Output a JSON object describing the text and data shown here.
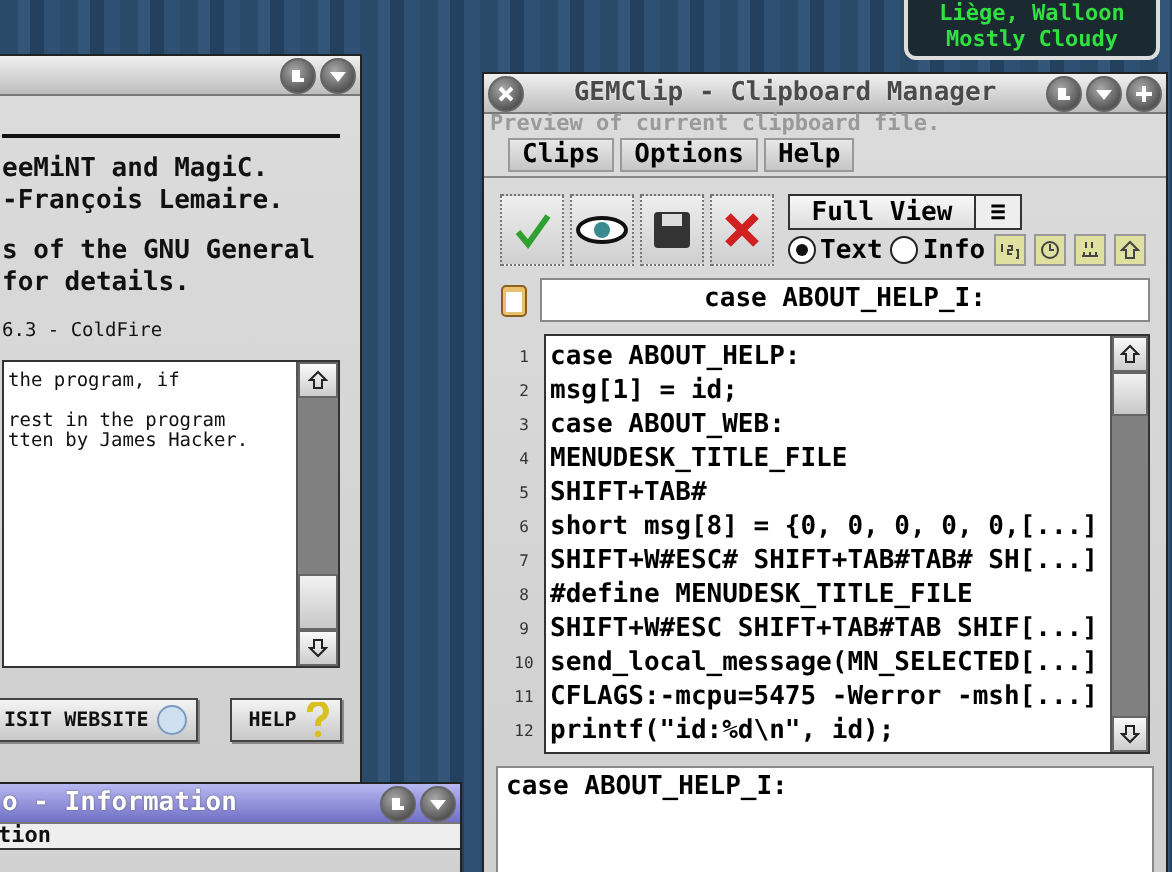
{
  "weather_widget": {
    "lines": [
      "Liège, Walloon",
      "Mostly Cloudy"
    ]
  },
  "about_window": {
    "text_lines": [
      "eeMiNT and MagiC.",
      "-François Lemaire."
    ],
    "license_lines": [
      "s of the GNU General",
      "for details."
    ],
    "version": "6.3 - ColdFire",
    "notes": [
      [
        "the program, if"
      ],
      [
        "rest in the program",
        "tten by James Hacker."
      ]
    ],
    "buttons": [
      {
        "label": "ISIT WEBSITE",
        "kind": "web"
      },
      {
        "label": "HELP",
        "kind": "help"
      }
    ]
  },
  "info_window": {
    "title": "o - Information",
    "header": "tion"
  },
  "clip_window": {
    "title": "GEMClip - Clipboard Manager",
    "status": "Preview of current clipboard file.",
    "menu": [
      "Clips",
      "Options",
      "Help"
    ],
    "view_select": "Full View",
    "menu_glyph": "≡",
    "radios": [
      {
        "label": "Text",
        "selected": true
      },
      {
        "label": "Info",
        "selected": false
      }
    ],
    "current_clip": "case ABOUT_HELP_I:",
    "clips": [
      {
        "number": "1",
        "text": "case ABOUT_HELP:"
      },
      {
        "number": "2",
        "text": "msg[1] = id;"
      },
      {
        "number": "3",
        "text": "case ABOUT_WEB:"
      },
      {
        "number": "4",
        "text": "MENUDESK_TITLE_FILE"
      },
      {
        "number": "5",
        "text": "SHIFT+TAB#"
      },
      {
        "number": "6",
        "text": "short msg[8] = {0, 0, 0, 0, 0,[...]"
      },
      {
        "number": "7",
        "text": "SHIFT+W#ESC# SHIFT+TAB#TAB# SH[...]"
      },
      {
        "number": "8",
        "text": "#define MENUDESK_TITLE_FILE"
      },
      {
        "number": "9",
        "text": "SHIFT+W#ESC SHIFT+TAB#TAB SHIF[...]"
      },
      {
        "number": "10",
        "text": "send_local_message(MN_SELECTED[...]"
      },
      {
        "number": "11",
        "text": "CFLAGS:-mcpu=5475 -Werror -msh[...]"
      },
      {
        "number": "12",
        "text": "printf(\"id:%d\\n\", id);"
      }
    ],
    "preview": "case ABOUT_HELP_I:"
  }
}
